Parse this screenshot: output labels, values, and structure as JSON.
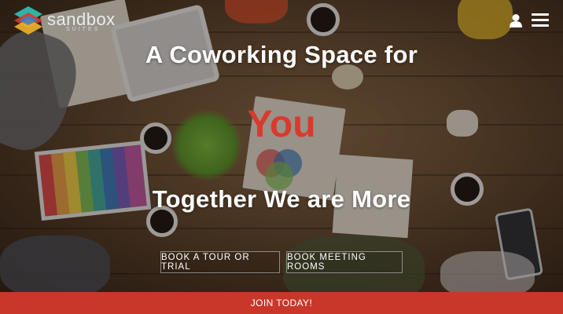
{
  "brand": {
    "name": "sandbox",
    "subtitle": "SUITES",
    "colors": {
      "red": "#d93a2c",
      "teal": "#2fb3a6",
      "yellow": "#f0b429",
      "blue": "#3b7fc4"
    }
  },
  "header": {
    "user_icon": "user-icon",
    "menu_icon": "hamburger-menu-icon"
  },
  "hero": {
    "headline_top": "A Coworking Space for",
    "headline_emphasis": "You",
    "headline_bottom": "Together We are More",
    "emphasis_color": "#d93a2c"
  },
  "ctas": {
    "tour_label": "BOOK A TOUR OR TRIAL",
    "rooms_label": "BOOK MEETING ROOMS"
  },
  "footer_bar": {
    "label": "JOIN TODAY!",
    "color": "#c8372a"
  }
}
